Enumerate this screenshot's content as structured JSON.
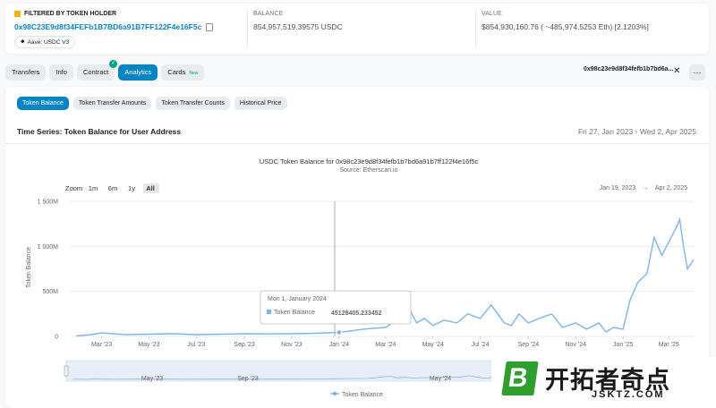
{
  "header": {
    "filter_label": "FILTERED BY TOKEN HOLDER",
    "holder_address": "0x98C23E9d8f34FEFb1B7BD6a91B7FF122F4e16F5c",
    "tag": "Aave: USDC V3",
    "balance_label": "BALANCE",
    "balance_value": "854,957,519.39575 USDC",
    "value_label": "VALUE",
    "value_value": "$854,930,160.76 ( ~485,974.5253 Eth) [2.1203%]"
  },
  "tabs": [
    {
      "label": "Transfers"
    },
    {
      "label": "Info"
    },
    {
      "label": "Contract"
    },
    {
      "label": "Analytics"
    },
    {
      "label": "Cards",
      "badge": "New"
    }
  ],
  "filter_address": "0x98c23e9d8f34fefb1b7bd6a...",
  "subtabs": [
    "Token Balance",
    "Token Transfer Amounts",
    "Token Transfer Counts",
    "Historical Price"
  ],
  "section": {
    "title": "Time Series: Token Balance for User Address",
    "range": "Fri 27, Jan 2023 - Wed 2, Apr 2025"
  },
  "colors": {
    "accent": "#0784c3",
    "series": "#7cb5ec",
    "success": "#00a186"
  },
  "chart_data": {
    "type": "line",
    "title": "USDC Token Balance for 0x98c23e9d8f34fefb1b7bd6a91b7ff122f4e16f5c",
    "subtitle": "Source: Etherscan.io",
    "zoom_label": "Zoom",
    "zoom_options": [
      "1m",
      "6m",
      "1y",
      "All"
    ],
    "zoom_selected": "All",
    "range_from": "Jan 19, 2023",
    "range_arrow": "→",
    "range_to": "Apr 2, 2025",
    "ylabel": "Token Balance",
    "ylim": [
      0,
      1500000000
    ],
    "yticks": [
      "0",
      "500M",
      "1 000M",
      "1 500M"
    ],
    "xticks": [
      "Mar '23",
      "May '23",
      "Jul '23",
      "Sep '23",
      "Nov '23",
      "Jan '24",
      "Mar '24",
      "May '24",
      "Jul '24",
      "Sep '24",
      "Nov '24",
      "Jan '25",
      "Mar '25"
    ],
    "navigator_ticks": [
      "May '23",
      "Sep '23",
      "May '24"
    ],
    "legend": "Token Balance",
    "grid": true,
    "tooltip": {
      "date": "Mon 1, January 2024",
      "series": "Token Balance",
      "value": "45128405.233452"
    },
    "series": [
      {
        "name": "Token Balance",
        "x": [
          "2023-01-27",
          "2023-02-15",
          "2023-03-01",
          "2023-03-15",
          "2023-04-01",
          "2023-05-01",
          "2023-06-01",
          "2023-07-01",
          "2023-08-01",
          "2023-09-01",
          "2023-10-01",
          "2023-11-01",
          "2023-12-01",
          "2024-01-01",
          "2024-01-15",
          "2024-02-01",
          "2024-02-15",
          "2024-03-01",
          "2024-03-10",
          "2024-03-20",
          "2024-04-01",
          "2024-04-10",
          "2024-04-20",
          "2024-05-01",
          "2024-05-15",
          "2024-06-01",
          "2024-06-15",
          "2024-07-01",
          "2024-07-15",
          "2024-08-01",
          "2024-08-10",
          "2024-08-20",
          "2024-09-01",
          "2024-09-15",
          "2024-10-01",
          "2024-10-15",
          "2024-11-01",
          "2024-11-15",
          "2024-12-01",
          "2024-12-10",
          "2024-12-20",
          "2025-01-01",
          "2025-01-10",
          "2025-01-20",
          "2025-02-01",
          "2025-02-10",
          "2025-02-20",
          "2025-03-01",
          "2025-03-10",
          "2025-03-15",
          "2025-03-20",
          "2025-03-25",
          "2025-04-02"
        ],
        "values": [
          5000000,
          20000000,
          40000000,
          30000000,
          20000000,
          25000000,
          30000000,
          20000000,
          25000000,
          30000000,
          28000000,
          30000000,
          35000000,
          45128405,
          60000000,
          80000000,
          90000000,
          100000000,
          150000000,
          250000000,
          300000000,
          150000000,
          200000000,
          120000000,
          180000000,
          150000000,
          250000000,
          200000000,
          350000000,
          150000000,
          120000000,
          250000000,
          150000000,
          200000000,
          250000000,
          100000000,
          150000000,
          80000000,
          150000000,
          50000000,
          100000000,
          80000000,
          400000000,
          600000000,
          700000000,
          1100000000,
          900000000,
          1050000000,
          1200000000,
          1300000000,
          1000000000,
          750000000,
          850000000
        ]
      }
    ]
  }
}
